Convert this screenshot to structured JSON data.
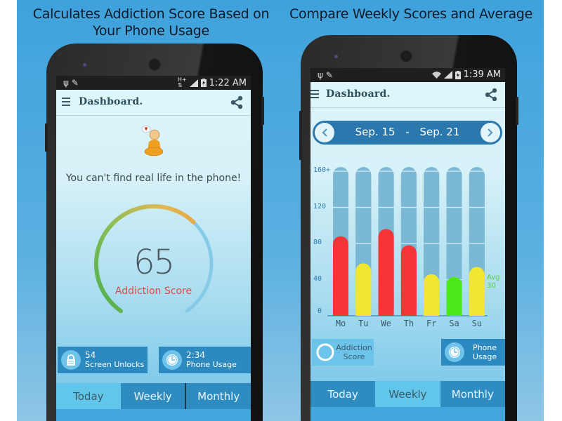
{
  "captions": {
    "left": "Calculates Addiction Score Based on Your Phone Usage",
    "right": "Compare Weekly Scores and Average"
  },
  "colors": {
    "background": "#4ba8de",
    "screen_bg": "#dff6fa",
    "tab_active": "#62c6ea",
    "tab_inactive": "#2f8cc0",
    "score_label": "#e04848",
    "bar_red": "#f53535",
    "bar_yellow": "#f2e730",
    "bar_green": "#4de81c",
    "avg_text": "#5ad040"
  },
  "left_phone": {
    "status_bar": {
      "left_icons": [
        "usb-icon",
        "pencil-icon"
      ],
      "right_icons": [
        "h-plus-data-icon",
        "signal-icon",
        "battery-charging-icon"
      ],
      "time": "1:22 AM"
    },
    "app_bar": {
      "title": "Dashboard.",
      "menu_icon": "hamburger-icon",
      "share_icon": "share-icon"
    },
    "mascot": {
      "icon": "monk-mascot-icon"
    },
    "quote": "You can't find real life in the phone!",
    "gauge": {
      "score": "65",
      "label": "Addiction Score",
      "fraction": 0.65
    },
    "stats": [
      {
        "icon": "lock-icon",
        "value": "54",
        "label": "Screen Unlocks"
      },
      {
        "icon": "clock-icon",
        "value": "2:34",
        "label": "Phone Usage"
      }
    ],
    "tabs": [
      {
        "label": "Today",
        "active": true
      },
      {
        "label": "Weekly",
        "active": false
      },
      {
        "label": "Monthly",
        "active": false
      }
    ]
  },
  "right_phone": {
    "status_bar": {
      "left_icons": [
        "usb-icon",
        "pencil-icon"
      ],
      "right_icons": [
        "wifi-icon",
        "signal-icon",
        "battery-charging-icon"
      ],
      "time": "1:39 AM"
    },
    "app_bar": {
      "title": "Dashboard.",
      "menu_icon": "hamburger-icon",
      "share_icon": "share-icon"
    },
    "date_range": {
      "start": "Sep. 15",
      "separator": "-",
      "end": "Sep. 21"
    },
    "avg": {
      "label": "Avg",
      "value": "30"
    },
    "legend": [
      {
        "icon": "ring-icon",
        "label": "Addiction Score",
        "active": false
      },
      {
        "icon": "clock-icon",
        "label": "Phone Usage",
        "active": true
      }
    ],
    "tabs": [
      {
        "label": "Today",
        "active": false
      },
      {
        "label": "Weekly",
        "active": true
      },
      {
        "label": "Monthly",
        "active": false
      }
    ]
  },
  "chart_data": {
    "type": "bar",
    "title": "",
    "xlabel": "",
    "ylabel": "",
    "categories": [
      "Mo",
      "Tu",
      "We",
      "Th",
      "Fr",
      "Sa",
      "Su"
    ],
    "values": [
      88,
      58,
      96,
      78,
      46,
      43,
      54
    ],
    "bar_colors": [
      "red",
      "yellow",
      "red",
      "red",
      "yellow",
      "green",
      "yellow"
    ],
    "yticks": [
      "0",
      "40",
      "80",
      "120",
      "160+"
    ],
    "ytick_values": [
      0,
      40,
      80,
      120,
      160
    ],
    "ylim": [
      0,
      160
    ],
    "grid": true,
    "annotation": "Avg 30"
  }
}
